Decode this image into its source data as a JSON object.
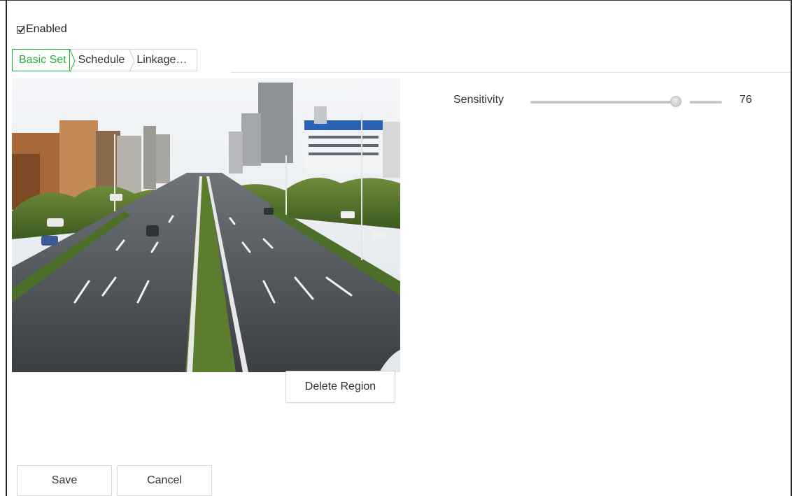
{
  "enabled": {
    "label": "Enabled",
    "checked": true
  },
  "tabs": [
    {
      "label": "Basic Set",
      "active": true
    },
    {
      "label": "Schedule",
      "active": false
    },
    {
      "label": "Linkage…",
      "active": false
    }
  ],
  "video": {
    "scene": "camera-preview"
  },
  "actions": {
    "delete_region": "Delete Region",
    "save": "Save",
    "cancel": "Cancel"
  },
  "sensitivity": {
    "label": "Sensitivity",
    "value": "76",
    "fraction": 0.76
  },
  "colors": {
    "accent": "#22b33a",
    "track": "#c9c9c9",
    "border": "#d5d5d5"
  }
}
